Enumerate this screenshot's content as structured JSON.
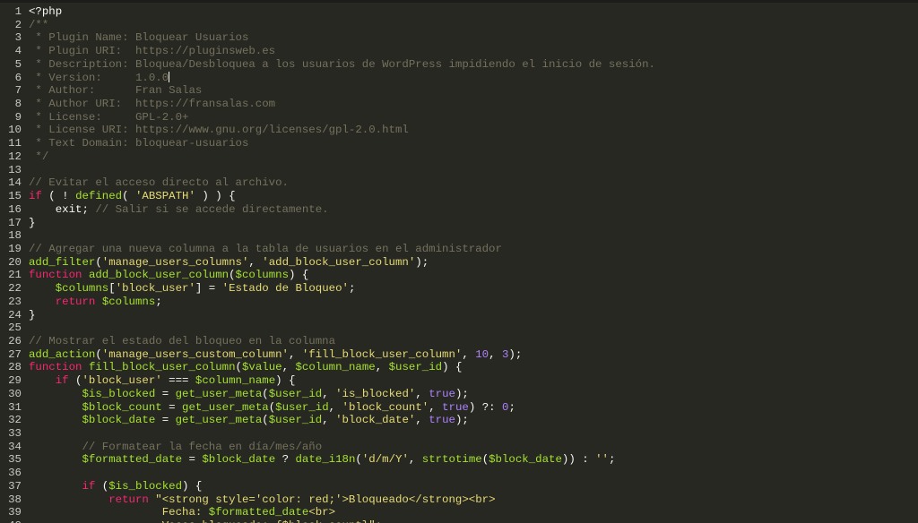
{
  "editor": {
    "theme": {
      "background": "#272822",
      "comment": "#75715e",
      "keyword": "#f92672",
      "string": "#e6db74",
      "function": "#a6e22e",
      "number": "#ae81ff",
      "text": "#f8f8f2"
    },
    "cursor_line": 6,
    "lines": [
      {
        "n": "1",
        "t": [
          [
            "p",
            "<?php"
          ]
        ]
      },
      {
        "n": "2",
        "t": [
          [
            "c",
            "/**"
          ]
        ]
      },
      {
        "n": "3",
        "t": [
          [
            "c",
            " * Plugin Name: Bloquear Usuarios"
          ]
        ]
      },
      {
        "n": "4",
        "t": [
          [
            "c",
            " * Plugin URI:  https://pluginsweb.es"
          ]
        ]
      },
      {
        "n": "5",
        "t": [
          [
            "c",
            " * Description: Bloquea/Desbloquea a los usuarios de WordPress impidiendo el inicio de sesión."
          ]
        ]
      },
      {
        "n": "6",
        "t": [
          [
            "c",
            " * Version:     1.0.0"
          ]
        ]
      },
      {
        "n": "7",
        "t": [
          [
            "c",
            " * Author:      Fran Salas"
          ]
        ]
      },
      {
        "n": "8",
        "t": [
          [
            "c",
            " * Author URI:  https://fransalas.com"
          ]
        ]
      },
      {
        "n": "9",
        "t": [
          [
            "c",
            " * License:     GPL-2.0+"
          ]
        ]
      },
      {
        "n": "10",
        "t": [
          [
            "c",
            " * License URI: https://www.gnu.org/licenses/gpl-2.0.html"
          ]
        ]
      },
      {
        "n": "11",
        "t": [
          [
            "c",
            " * Text Domain: bloquear-usuarios"
          ]
        ]
      },
      {
        "n": "12",
        "t": [
          [
            "c",
            " */"
          ]
        ]
      },
      {
        "n": "13",
        "t": []
      },
      {
        "n": "14",
        "t": [
          [
            "c",
            "// Evitar el acceso directo al archivo."
          ]
        ]
      },
      {
        "n": "15",
        "t": [
          [
            "k",
            "if"
          ],
          [
            "p",
            " ( ! "
          ],
          [
            "f",
            "defined"
          ],
          [
            "p",
            "( "
          ],
          [
            "s",
            "'ABSPATH'"
          ],
          [
            "p",
            " ) ) {"
          ]
        ]
      },
      {
        "n": "16",
        "t": [
          [
            "p",
            "    exit; "
          ],
          [
            "c",
            "// Salir si se accede directamente."
          ]
        ]
      },
      {
        "n": "17",
        "t": [
          [
            "p",
            "}"
          ]
        ]
      },
      {
        "n": "18",
        "t": []
      },
      {
        "n": "19",
        "t": [
          [
            "c",
            "// Agregar una nueva columna a la tabla de usuarios en el administrador"
          ]
        ]
      },
      {
        "n": "20",
        "t": [
          [
            "f",
            "add_filter"
          ],
          [
            "p",
            "("
          ],
          [
            "s",
            "'manage_users_columns'"
          ],
          [
            "p",
            ", "
          ],
          [
            "s",
            "'add_block_user_column'"
          ],
          [
            "p",
            ");"
          ]
        ]
      },
      {
        "n": "21",
        "t": [
          [
            "k",
            "function"
          ],
          [
            "p",
            " "
          ],
          [
            "f",
            "add_block_user_column"
          ],
          [
            "p",
            "("
          ],
          [
            "v",
            "$columns"
          ],
          [
            "p",
            ") {"
          ]
        ]
      },
      {
        "n": "22",
        "t": [
          [
            "p",
            "    "
          ],
          [
            "v",
            "$columns"
          ],
          [
            "p",
            "["
          ],
          [
            "s",
            "'block_user'"
          ],
          [
            "p",
            "] = "
          ],
          [
            "s",
            "'Estado de Bloqueo'"
          ],
          [
            "p",
            ";"
          ]
        ]
      },
      {
        "n": "23",
        "t": [
          [
            "p",
            "    "
          ],
          [
            "k",
            "return"
          ],
          [
            "p",
            " "
          ],
          [
            "v",
            "$columns"
          ],
          [
            "p",
            ";"
          ]
        ]
      },
      {
        "n": "24",
        "t": [
          [
            "p",
            "}"
          ]
        ]
      },
      {
        "n": "25",
        "t": []
      },
      {
        "n": "26",
        "t": [
          [
            "c",
            "// Mostrar el estado del bloqueo en la columna"
          ]
        ]
      },
      {
        "n": "27",
        "t": [
          [
            "f",
            "add_action"
          ],
          [
            "p",
            "("
          ],
          [
            "s",
            "'manage_users_custom_column'"
          ],
          [
            "p",
            ", "
          ],
          [
            "s",
            "'fill_block_user_column'"
          ],
          [
            "p",
            ", "
          ],
          [
            "n",
            "10"
          ],
          [
            "p",
            ", "
          ],
          [
            "n",
            "3"
          ],
          [
            "p",
            ");"
          ]
        ]
      },
      {
        "n": "28",
        "t": [
          [
            "k",
            "function"
          ],
          [
            "p",
            " "
          ],
          [
            "f",
            "fill_block_user_column"
          ],
          [
            "p",
            "("
          ],
          [
            "v",
            "$value"
          ],
          [
            "p",
            ", "
          ],
          [
            "v",
            "$column_name"
          ],
          [
            "p",
            ", "
          ],
          [
            "v",
            "$user_id"
          ],
          [
            "p",
            ") {"
          ]
        ]
      },
      {
        "n": "29",
        "t": [
          [
            "p",
            "    "
          ],
          [
            "k",
            "if"
          ],
          [
            "p",
            " ("
          ],
          [
            "s",
            "'block_user'"
          ],
          [
            "p",
            " === "
          ],
          [
            "v",
            "$column_name"
          ],
          [
            "p",
            ") {"
          ]
        ]
      },
      {
        "n": "30",
        "t": [
          [
            "p",
            "        "
          ],
          [
            "v",
            "$is_blocked"
          ],
          [
            "p",
            " = "
          ],
          [
            "f",
            "get_user_meta"
          ],
          [
            "p",
            "("
          ],
          [
            "v",
            "$user_id"
          ],
          [
            "p",
            ", "
          ],
          [
            "s",
            "'is_blocked'"
          ],
          [
            "p",
            ", "
          ],
          [
            "n",
            "true"
          ],
          [
            "p",
            ");"
          ]
        ]
      },
      {
        "n": "31",
        "t": [
          [
            "p",
            "        "
          ],
          [
            "v",
            "$block_count"
          ],
          [
            "p",
            " = "
          ],
          [
            "f",
            "get_user_meta"
          ],
          [
            "p",
            "("
          ],
          [
            "v",
            "$user_id"
          ],
          [
            "p",
            ", "
          ],
          [
            "s",
            "'block_count'"
          ],
          [
            "p",
            ", "
          ],
          [
            "n",
            "true"
          ],
          [
            "p",
            ") ?: "
          ],
          [
            "n",
            "0"
          ],
          [
            "p",
            ";"
          ]
        ]
      },
      {
        "n": "32",
        "t": [
          [
            "p",
            "        "
          ],
          [
            "v",
            "$block_date"
          ],
          [
            "p",
            " = "
          ],
          [
            "f",
            "get_user_meta"
          ],
          [
            "p",
            "("
          ],
          [
            "v",
            "$user_id"
          ],
          [
            "p",
            ", "
          ],
          [
            "s",
            "'block_date'"
          ],
          [
            "p",
            ", "
          ],
          [
            "n",
            "true"
          ],
          [
            "p",
            ");"
          ]
        ]
      },
      {
        "n": "33",
        "t": []
      },
      {
        "n": "34",
        "t": [
          [
            "p",
            "        "
          ],
          [
            "c",
            "// Formatear la fecha en día/mes/año"
          ]
        ]
      },
      {
        "n": "35",
        "t": [
          [
            "p",
            "        "
          ],
          [
            "v",
            "$formatted_date"
          ],
          [
            "p",
            " = "
          ],
          [
            "v",
            "$block_date"
          ],
          [
            "p",
            " ? "
          ],
          [
            "f",
            "date_i18n"
          ],
          [
            "p",
            "("
          ],
          [
            "s",
            "'d/m/Y'"
          ],
          [
            "p",
            ", "
          ],
          [
            "f",
            "strtotime"
          ],
          [
            "p",
            "("
          ],
          [
            "v",
            "$block_date"
          ],
          [
            "p",
            ")) : "
          ],
          [
            "s",
            "''"
          ],
          [
            "p",
            ";"
          ]
        ]
      },
      {
        "n": "36",
        "t": []
      },
      {
        "n": "37",
        "t": [
          [
            "p",
            "        "
          ],
          [
            "k",
            "if"
          ],
          [
            "p",
            " ("
          ],
          [
            "v",
            "$is_blocked"
          ],
          [
            "p",
            ") {"
          ]
        ]
      },
      {
        "n": "38",
        "t": [
          [
            "p",
            "            "
          ],
          [
            "k",
            "return"
          ],
          [
            "p",
            " "
          ],
          [
            "s",
            "\"<strong style='color: red;'>Bloqueado</strong><br>"
          ]
        ]
      },
      {
        "n": "39",
        "t": [
          [
            "s",
            "                    Fecha: "
          ],
          [
            "v",
            "$formatted_date"
          ],
          [
            "s",
            "<br>"
          ]
        ]
      },
      {
        "n": "40",
        "t": [
          [
            "s",
            "                    Veces bloqueado: {$block_count}\";"
          ]
        ]
      }
    ]
  }
}
